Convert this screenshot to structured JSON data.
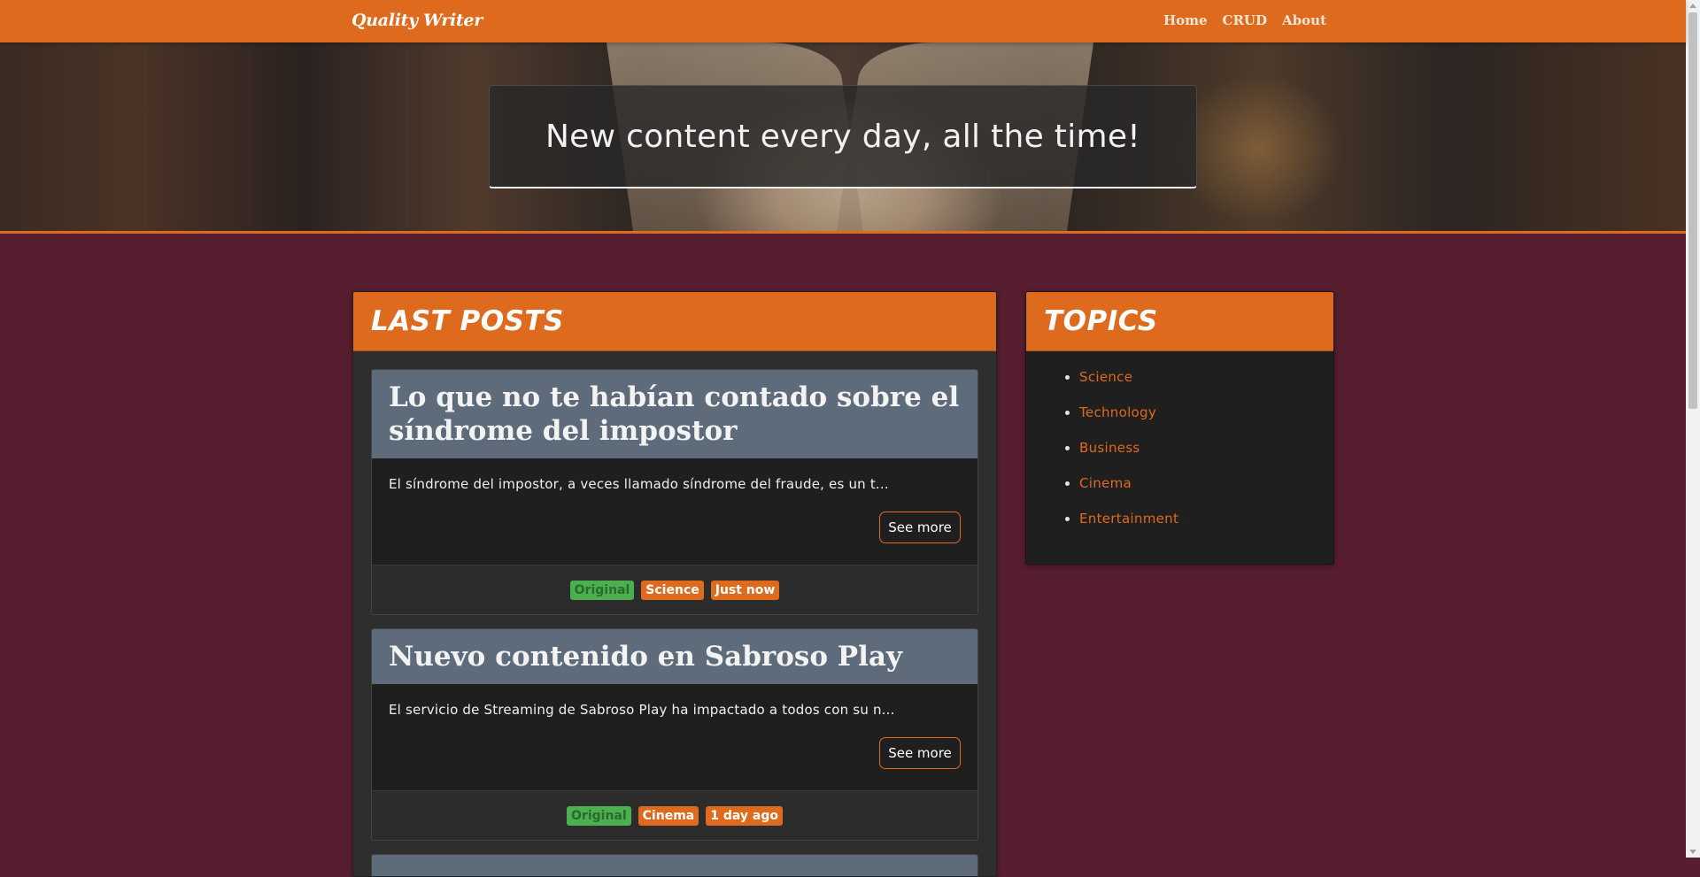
{
  "navbar": {
    "brand": "Quality Writer",
    "links": [
      "Home",
      "CRUD",
      "About"
    ]
  },
  "hero": {
    "tagline": "New content every day, all the time!"
  },
  "posts": {
    "title": "Last Posts",
    "items": [
      {
        "title": "Lo que no te habían contado sobre el síndrome del impostor",
        "excerpt": "El síndrome del impostor, a veces llamado síndrome del fraude, es un t...",
        "button": "See more",
        "badges": [
          "Original",
          "Science",
          "Just now"
        ]
      },
      {
        "title": "Nuevo contenido en Sabroso Play",
        "excerpt": "El servicio de Streaming de Sabroso Play ha impactado a todos con su n...",
        "button": "See more",
        "badges": [
          "Original",
          "Cinema",
          "1 day ago"
        ]
      }
    ]
  },
  "topics": {
    "title": "Topics",
    "items": [
      "Science",
      "Technology",
      "Business",
      "Cinema",
      "Entertainment"
    ]
  },
  "colors": {
    "accent": "#de6a1e",
    "background": "#561e2e",
    "post_header": "#5d6b7a",
    "badge_original": "#4caf50"
  }
}
